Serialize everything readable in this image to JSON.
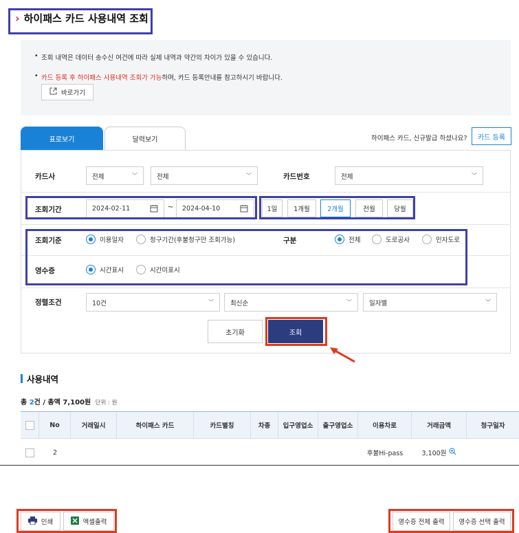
{
  "page_title": "하이패스 카드 사용내역 조회",
  "notice": {
    "line1": "조회 내역은 데이터 송수신 여건에 따라 실제 내역과 약간의 차이가 있을 수 있습니다.",
    "line2_red": "카드 등록 후 하이패스 사용내역 조회가 가능",
    "line2_rest": "하며, 카드 등록안내를 참고하시기 바랍니다.",
    "goto_label": "바로가기"
  },
  "tabs": {
    "table": "표로보기",
    "calendar": "달력보기"
  },
  "new_card_question": "하이패스 카드, 신규발급 하셨나요?",
  "card_register_button": "카드 등록",
  "form": {
    "card_company_label": "카드사",
    "card_company_value1": "전체",
    "card_company_value2": "전체",
    "card_number_label": "카드번호",
    "card_number_value": "전체",
    "period_label": "조회기간",
    "date_from": "2024-02-11",
    "date_sep": "~",
    "date_to": "2024-04-10",
    "period_buttons": [
      "1일",
      "1개월",
      "2개월",
      "전월",
      "당월"
    ],
    "criteria_label": "조회기준",
    "criteria_options": [
      "이용일자",
      "청구기간(후불청구만 조회가능)"
    ],
    "category_label": "구분",
    "category_options": [
      "전체",
      "도로공사",
      "민자도로"
    ],
    "receipt_label": "영수증",
    "receipt_options": [
      "시간표시",
      "시간미표시"
    ],
    "sort_label": "정렬조건",
    "sort_count": "10건",
    "sort_order": "최신순",
    "sort_group": "일자별",
    "reset_button": "초기화",
    "search_button": "조회"
  },
  "usage": {
    "section_title": "사용내역",
    "summary_prefix": "총 ",
    "summary_count": "2",
    "summary_mid": "건 / 총액 7,100원",
    "summary_unit": "단위 : 원",
    "columns": [
      "No",
      "거래일시",
      "하이패스 카드",
      "카드별칭",
      "차종",
      "입구영업소",
      "출구영업소",
      "이용차로",
      "거래금액",
      "청구일자"
    ],
    "row1": {
      "no": "2",
      "lane": "후불Hi-pass",
      "amount": "3,100원"
    }
  },
  "bottom": {
    "print": "인쇄",
    "excel": "엑셀출력",
    "receipt_all": "영수증 전체 출력",
    "receipt_selected": "영수증 선택 출력"
  },
  "colors": {
    "accent": "#1a82d6",
    "primary_button": "#2b3d7f",
    "highlight_blue": "#3f3fa8",
    "highlight_red": "#e0391d"
  }
}
